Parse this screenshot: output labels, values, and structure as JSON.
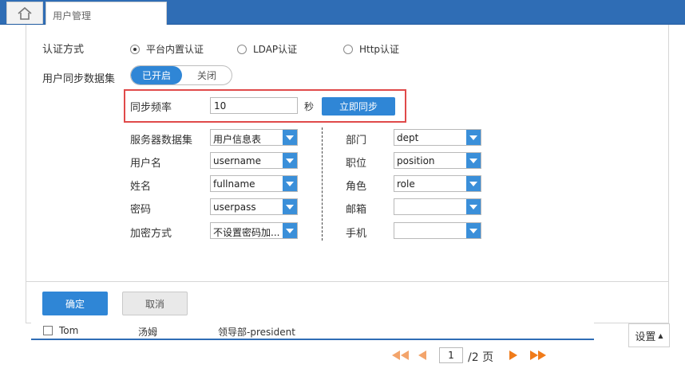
{
  "topbar": {
    "home_icon": "home-icon",
    "tab_label": "用户管理"
  },
  "auth": {
    "label": "认证方式",
    "options": [
      {
        "label": "平台内置认证",
        "selected": true
      },
      {
        "label": "LDAP认证",
        "selected": false
      },
      {
        "label": "Http认证",
        "selected": false
      }
    ]
  },
  "sync": {
    "label": "用户同步数据集",
    "toggle_on": "已开启",
    "toggle_off": "关闭",
    "freq_label": "同步频率",
    "freq_value": "10",
    "freq_unit": "秒",
    "sync_now": "立即同步"
  },
  "left_fields": [
    {
      "label": "服务器数据集",
      "value": "用户信息表"
    },
    {
      "label": "用户名",
      "value": "username"
    },
    {
      "label": "姓名",
      "value": "fullname"
    },
    {
      "label": "密码",
      "value": "userpass"
    },
    {
      "label": "加密方式",
      "value": "不设置密码加..."
    }
  ],
  "right_fields": [
    {
      "label": "部门",
      "value": "dept"
    },
    {
      "label": "职位",
      "value": "position"
    },
    {
      "label": "角色",
      "value": "role"
    },
    {
      "label": "邮箱",
      "value": ""
    },
    {
      "label": "手机",
      "value": ""
    }
  ],
  "footer": {
    "ok": "确定",
    "cancel": "取消"
  },
  "table_row": {
    "name": "Tom",
    "chinese_name": "汤姆",
    "dept": "领导部-president"
  },
  "settings": {
    "label": "设置",
    "icon": "caret-up-icon"
  },
  "pager": {
    "page": "1",
    "total": "/2 页"
  },
  "colors": {
    "accent": "#2f86d6",
    "topbar": "#2f6db5",
    "highlight": "#e04a4a",
    "pager": "#f07b1a"
  }
}
